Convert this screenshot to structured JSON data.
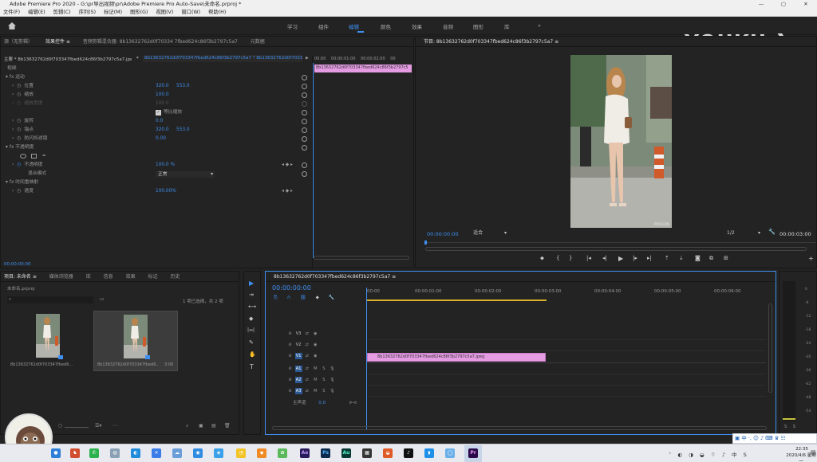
{
  "window": {
    "title": "Adobe Premiere Pro 2020 - G:\\pr导出视频\\pr\\Adobe Premiere Pro Auto-Save\\未命名.prproj *",
    "controls": [
      "—",
      "▢",
      "✕"
    ]
  },
  "menu": [
    "文件(F)",
    "编辑(E)",
    "剪辑(C)",
    "序列(S)",
    "标记(M)",
    "图形(G)",
    "视图(V)",
    "窗口(W)",
    "帮助(H)"
  ],
  "workspaces": [
    "学习",
    "组件",
    "编辑",
    "颜色",
    "效果",
    "音频",
    "图形",
    "库",
    "»"
  ],
  "active_workspace": "编辑",
  "watermark": "YOUKU",
  "effect_controls": {
    "tabs": [
      "源（无剪辑）",
      "效果控件 ≡",
      "音频剪辑混合器: 8b13632762d0f70334 7fbed624c86f3b2797c5a7",
      "元数据"
    ],
    "master_path": "主要 * 8b13632762d0f703347fbed624c86f3b2797c5a7.jpeg",
    "clip_path": "8b13632762d0f703347fbed624c86f3b2797c5a7 * 8b13632762d0f703347fbed624c86f3b2797c5a7.jpeg",
    "section_video": "视频",
    "motion": "fx 运动",
    "position_label": "位置",
    "position_x": "320.0",
    "position_y": "553.0",
    "scale_label": "缩放",
    "scale_val": "100.0",
    "scale_w_label": "缩放宽度",
    "scale_w_val": "100.0",
    "uniform_label": "等比缩放",
    "rotation_label": "旋转",
    "rotation_val": "0.0",
    "anchor_label": "锚点",
    "anchor_x": "320.0",
    "anchor_y": "553.0",
    "antiflicker_label": "防闪烁滤镜",
    "antiflicker_val": "0.00",
    "opacity_section": "fx 不透明度",
    "opacity_label": "不透明度",
    "opacity_val": "100.0 %",
    "blend_label": "混合模式",
    "blend_val": "正常",
    "time_remap": "fx 时间重映射",
    "speed_label": "速度",
    "speed_val": "100.00%",
    "mini_ruler": [
      "00:00",
      "00:00:01:00",
      "00:00:02:00",
      "00"
    ],
    "mini_clip": "8b13632762d0f703347fbed624c86f3b2797c5",
    "timecode": "00:00:00:00"
  },
  "program_monitor": {
    "tab": "节目: 8b13632762d0f703347fbed624c86f3b2797c5a7  ≡",
    "timecode": "00:00:00:00",
    "fit": "适合",
    "resolution": "1/2",
    "duration": "00:00:03:00"
  },
  "project": {
    "tabs": [
      "项目: 未命名  ≡",
      "媒体浏览器",
      "库",
      "信息",
      "效果",
      "标记",
      "历史"
    ],
    "project_file": "未命名.prproj",
    "selection_info": "1 项已选择，共 2 项",
    "items": [
      {
        "name": "8b13632762d0f703347fbed6...",
        "duration": ""
      },
      {
        "name": "8b13632762d0f703347fbed6...",
        "duration": "3:00"
      }
    ]
  },
  "tools": [
    "▶",
    "⇥",
    "⟷",
    "◆",
    "|↔|",
    "✎",
    "✋",
    "T"
  ],
  "timeline": {
    "tab": "8b13632762d0f703347fbed624c86f3b2797c5a7  ≡",
    "timecode": "00:00:00:00",
    "ruler": [
      "00:00",
      "00:00:01:00",
      "00:00:02:00",
      "00:00:03:00",
      "00:00:04:00",
      "00:00:05:00",
      "00:00:06:00"
    ],
    "video_tracks": [
      "V3",
      "V2",
      "V1"
    ],
    "audio_tracks": [
      "A1",
      "A2",
      "A3"
    ],
    "master_label": "主声道",
    "master_val": "0.0",
    "clip_name": "8b13632762d0f703347fbed624c86f3b2797c5a7.jpeg",
    "audio_btns": [
      "M",
      "S"
    ]
  },
  "meter": {
    "labels": [
      "0",
      "-6",
      "-12",
      "-18",
      "-24",
      "-30",
      "-36",
      "-42",
      "-48",
      "-54"
    ],
    "solo": [
      "S",
      "S"
    ]
  },
  "systray": {
    "ime": "中",
    "time": "22:35",
    "date": "2020/4/6 星期一"
  },
  "taskbar_apps": [
    {
      "label": "Ae",
      "color": "#2a1a5e"
    },
    {
      "label": "Ps",
      "color": "#0a2a4e"
    },
    {
      "label": "Au",
      "color": "#073a32"
    },
    {
      "label": "Pr",
      "color": "#2a0a4a"
    }
  ]
}
